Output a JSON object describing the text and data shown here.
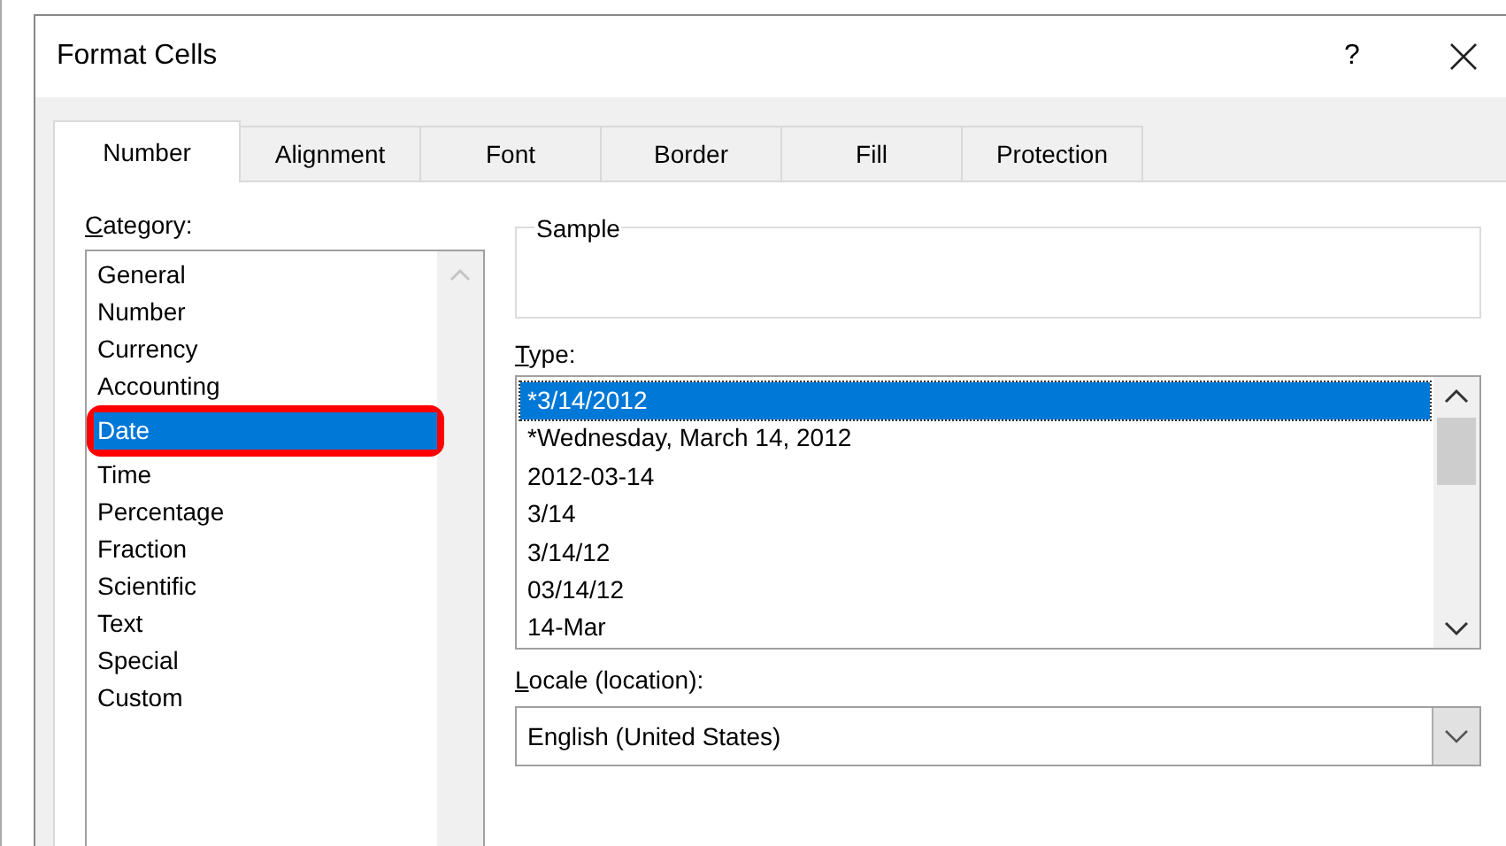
{
  "window": {
    "title": "Format Cells",
    "help": "?"
  },
  "tabs": [
    {
      "label": "Number",
      "selected": true
    },
    {
      "label": "Alignment",
      "selected": false
    },
    {
      "label": "Font",
      "selected": false
    },
    {
      "label": "Border",
      "selected": false
    },
    {
      "label": "Fill",
      "selected": false
    },
    {
      "label": "Protection",
      "selected": false
    }
  ],
  "category": {
    "label": "Category:",
    "items": [
      {
        "label": "General",
        "selected": false
      },
      {
        "label": "Number",
        "selected": false
      },
      {
        "label": "Currency",
        "selected": false
      },
      {
        "label": "Accounting",
        "selected": false
      },
      {
        "label": "Date",
        "selected": true
      },
      {
        "label": "Time",
        "selected": false
      },
      {
        "label": "Percentage",
        "selected": false
      },
      {
        "label": "Fraction",
        "selected": false
      },
      {
        "label": "Scientific",
        "selected": false
      },
      {
        "label": "Text",
        "selected": false
      },
      {
        "label": "Special",
        "selected": false
      },
      {
        "label": "Custom",
        "selected": false
      }
    ]
  },
  "sample": {
    "label": "Sample"
  },
  "type": {
    "label": "Type:",
    "items": [
      {
        "label": "*3/14/2012",
        "selected": true
      },
      {
        "label": "*Wednesday, March 14, 2012",
        "selected": false
      },
      {
        "label": "2012-03-14",
        "selected": false
      },
      {
        "label": "3/14",
        "selected": false
      },
      {
        "label": "3/14/12",
        "selected": false
      },
      {
        "label": "03/14/12",
        "selected": false
      },
      {
        "label": "14-Mar",
        "selected": false
      }
    ]
  },
  "locale": {
    "label": "Locale (location):",
    "value": "English (United States)"
  },
  "highlight": {
    "on": true
  }
}
